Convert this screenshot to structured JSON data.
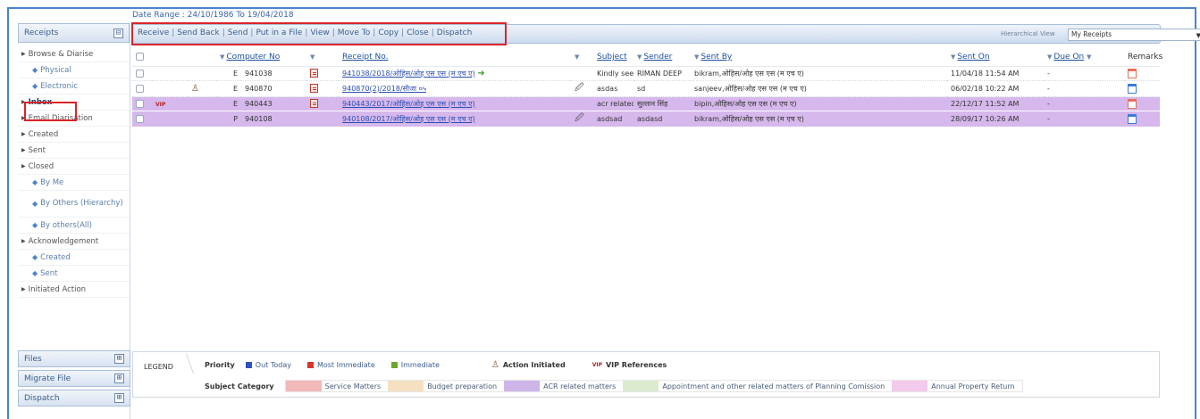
{
  "date_range": "Date Range : 24/10/1986 To 19/04/2018",
  "sidebar": {
    "receipts_label": "Receipts",
    "receipts_toggle": "⊟",
    "items": [
      {
        "label": "Browse & Diarise",
        "type": "arrow"
      },
      {
        "label": "Physical",
        "type": "sub"
      },
      {
        "label": "Electronic",
        "type": "sub"
      },
      {
        "label": "Inbox",
        "type": "arrow"
      },
      {
        "label": "Email Diarisation",
        "type": "arrow"
      },
      {
        "label": "Created",
        "type": "arrow"
      },
      {
        "label": "Sent",
        "type": "arrow"
      },
      {
        "label": "Closed",
        "type": "arrow"
      },
      {
        "label": "By Me",
        "type": "sub"
      },
      {
        "label": "By Others (Hierarchy)",
        "type": "sub"
      },
      {
        "label": "By others(All)",
        "type": "sub"
      },
      {
        "label": "Acknowledgement",
        "type": "arrow"
      },
      {
        "label": "Created",
        "type": "sub"
      },
      {
        "label": "Sent",
        "type": "sub"
      },
      {
        "label": "Initiated Action",
        "type": "arrow"
      }
    ],
    "panels": [
      {
        "label": "Files",
        "toggle": "⊞"
      },
      {
        "label": "Migrate File",
        "toggle": "⊞"
      },
      {
        "label": "Dispatch",
        "toggle": "⊞"
      }
    ]
  },
  "toolbar": {
    "buttons": [
      "Receive",
      "Send Back",
      "Send",
      "Put in a File",
      "View",
      "Move To",
      "Copy",
      "Close",
      "Dispatch"
    ],
    "hierarchical_view_label": "Hierarchical View",
    "hierarchical_view_value": "My Receipts"
  },
  "table": {
    "headers": {
      "computer_no": "Computer No",
      "receipt_no": "Receipt No.",
      "subject": "Subject",
      "sender": "Sender",
      "sent_by": "Sent By",
      "sent_on": "Sent On",
      "due_on": "Due On",
      "remarks": "Remarks"
    },
    "rows": [
      {
        "vip": "",
        "type": "E",
        "computer_no": "941038",
        "receipt_no": "941038/2018/ओहिस/ओह एस एस (म एच ए)",
        "subject": "Kindly see",
        "sender": "RIMAN DEEP",
        "sent_by": "bikram,ओहिस/ओह एस एस (म एच ए)",
        "sent_on": "11/04/18 11:54 AM",
        "due_on": "-"
      },
      {
        "vip": "",
        "type": "E",
        "computer_no": "940870",
        "receipt_no": "940870(2)/2018/सीजा ०५",
        "subject": "asdas",
        "sender": "sd",
        "sent_by": "sanjeev,ओहिस/ओह एस एस (म एच ए)",
        "sent_on": "06/02/18 10:22 AM",
        "due_on": "-"
      },
      {
        "vip": "VIP",
        "type": "E",
        "computer_no": "940443",
        "receipt_no": "940443/2017/ओहिस/ओह एस एस (म एच ए)",
        "subject": "acr related",
        "sender": "सुल्तान सिंह",
        "sent_by": "bipin,ओहिस/ओह एस एस (म एच ए)",
        "sent_on": "22/12/17 11:52 AM",
        "due_on": "-"
      },
      {
        "vip": "",
        "type": "P",
        "computer_no": "940108",
        "receipt_no": "940108/2017/ओहिस/ओह एस एस (म एच ए)",
        "subject": "asdsad",
        "sender": "asdasd",
        "sent_by": "bikram,ओहिस/ओह एस एस (म एच ए)",
        "sent_on": "28/09/17 10:26 AM",
        "due_on": "-"
      }
    ]
  },
  "legend": {
    "title": "LEGEND",
    "priority_label": "Priority",
    "priority_items": [
      {
        "label": "Out Today",
        "color": "#2f4fc4"
      },
      {
        "label": "Most Immediate",
        "color": "#d9352b"
      },
      {
        "label": "Immediate",
        "color": "#6aa72c"
      }
    ],
    "action_initiated": "Action Initiated",
    "vip_badge": "VIP",
    "vip_references": "VIP References",
    "subject_category_label": "Subject Category",
    "categories": [
      {
        "label": "Service Matters",
        "color": "#f3b8b8"
      },
      {
        "label": "Budget preparation",
        "color": "#f6e0c2"
      },
      {
        "label": "ACR related matters",
        "color": "#cdb5ea"
      },
      {
        "label": "Appointment and other related matters of Planning Comission",
        "color": "#dcebd0"
      },
      {
        "label": "Annual Property Return",
        "color": "#f3c9ec"
      }
    ]
  }
}
